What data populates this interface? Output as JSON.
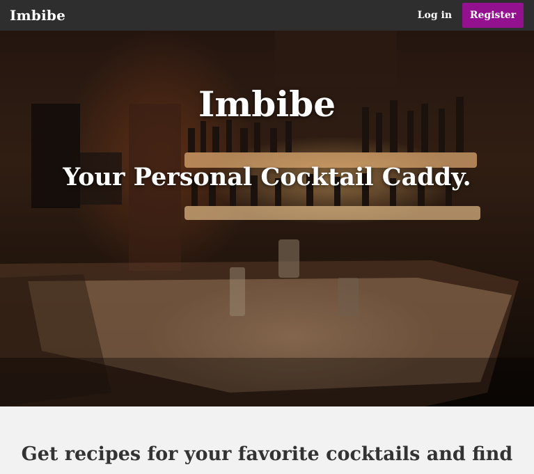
{
  "navbar": {
    "brand": "Imbibe",
    "login_label": "Log in",
    "register_label": "Register"
  },
  "hero": {
    "title": "Imbibe",
    "subtitle": "Your Personal Cocktail Caddy."
  },
  "intro": {
    "text": "Get recipes for your favorite cocktails and find"
  },
  "colors": {
    "navbar_bg": "#2e2e2e",
    "register_bg": "#93108f",
    "page_bg": "#f2f2f2",
    "intro_text": "#333333"
  }
}
